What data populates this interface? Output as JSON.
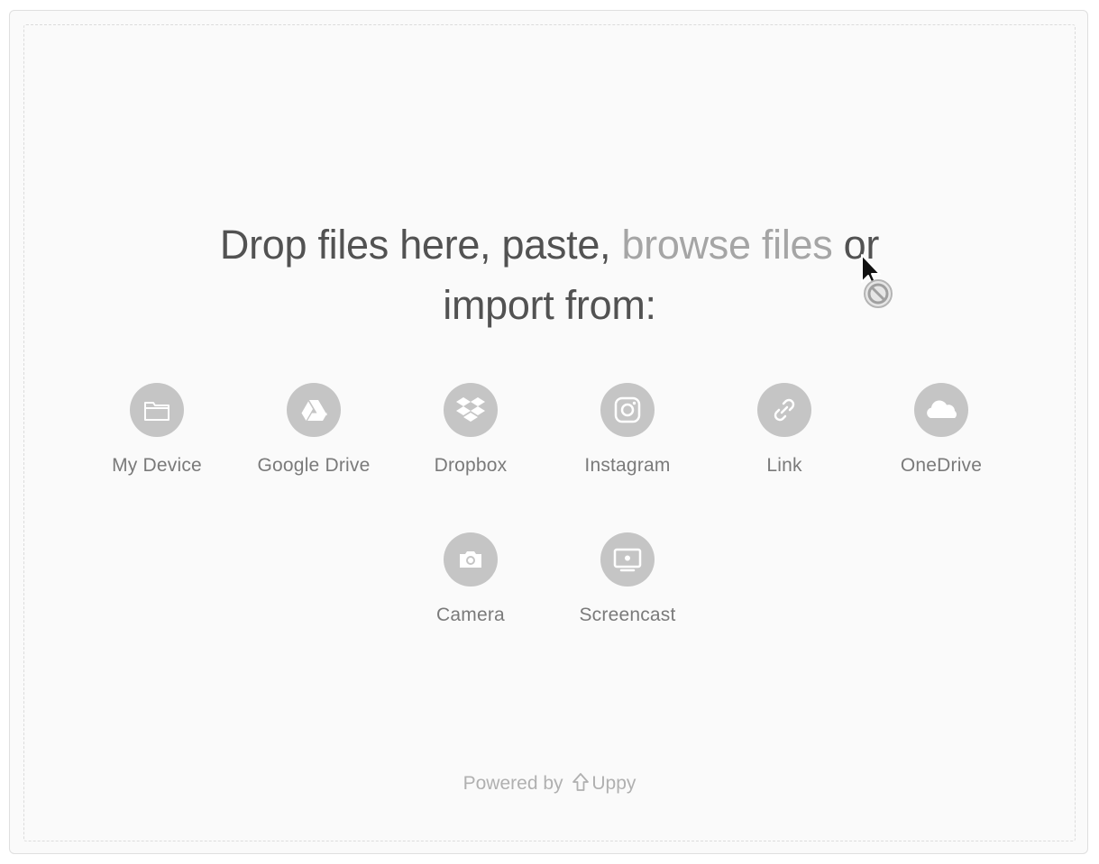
{
  "header": {
    "prefix": "Drop files here, paste, ",
    "browse_link": "browse files",
    "suffix": " or",
    "line2": "import from:"
  },
  "providers": [
    {
      "label": "My Device",
      "icon": "folder-icon"
    },
    {
      "label": "Google Drive",
      "icon": "google-drive-icon"
    },
    {
      "label": "Dropbox",
      "icon": "dropbox-icon"
    },
    {
      "label": "Instagram",
      "icon": "instagram-icon"
    },
    {
      "label": "Link",
      "icon": "link-icon"
    },
    {
      "label": "OneDrive",
      "icon": "onedrive-icon"
    },
    {
      "label": "Camera",
      "icon": "camera-icon"
    },
    {
      "label": "Screencast",
      "icon": "screencast-icon"
    }
  ],
  "footer": {
    "powered_by": "Powered by",
    "brand": "Uppy"
  },
  "colors": {
    "background": "#fafafa",
    "icon_circle": "#c5c5c5",
    "title_text": "#525252",
    "browse_link": "#a5a5a5",
    "label_text": "#7a7a7a"
  }
}
